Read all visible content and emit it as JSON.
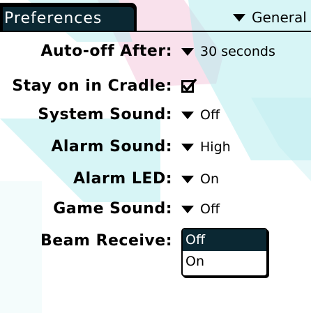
{
  "header": {
    "title": "Preferences",
    "category": "General"
  },
  "settings": [
    {
      "label": "Auto-off After:",
      "value": "30 seconds",
      "control": "dropdown"
    },
    {
      "label": "Stay on in Cradle:",
      "checked": true,
      "control": "checkbox"
    },
    {
      "label": "System Sound:",
      "value": "Off",
      "control": "dropdown"
    },
    {
      "label": "Alarm Sound:",
      "value": "High",
      "control": "dropdown"
    },
    {
      "label": "Alarm LED:",
      "value": "On",
      "control": "dropdown"
    },
    {
      "label": "Game Sound:",
      "value": "Off",
      "control": "dropdown"
    },
    {
      "label": "Beam Receive:",
      "control": "popup-list"
    }
  ],
  "beam_popup": {
    "options": [
      "Off",
      "On"
    ],
    "selected_index": 0
  },
  "colors": {
    "accent": "#0b2833",
    "watermark": "#b7ecee",
    "watermark_pink": "#f4c9dd"
  },
  "icons": {
    "dropdown": "triangle-down-icon",
    "checkbox": "checkmark-icon"
  }
}
